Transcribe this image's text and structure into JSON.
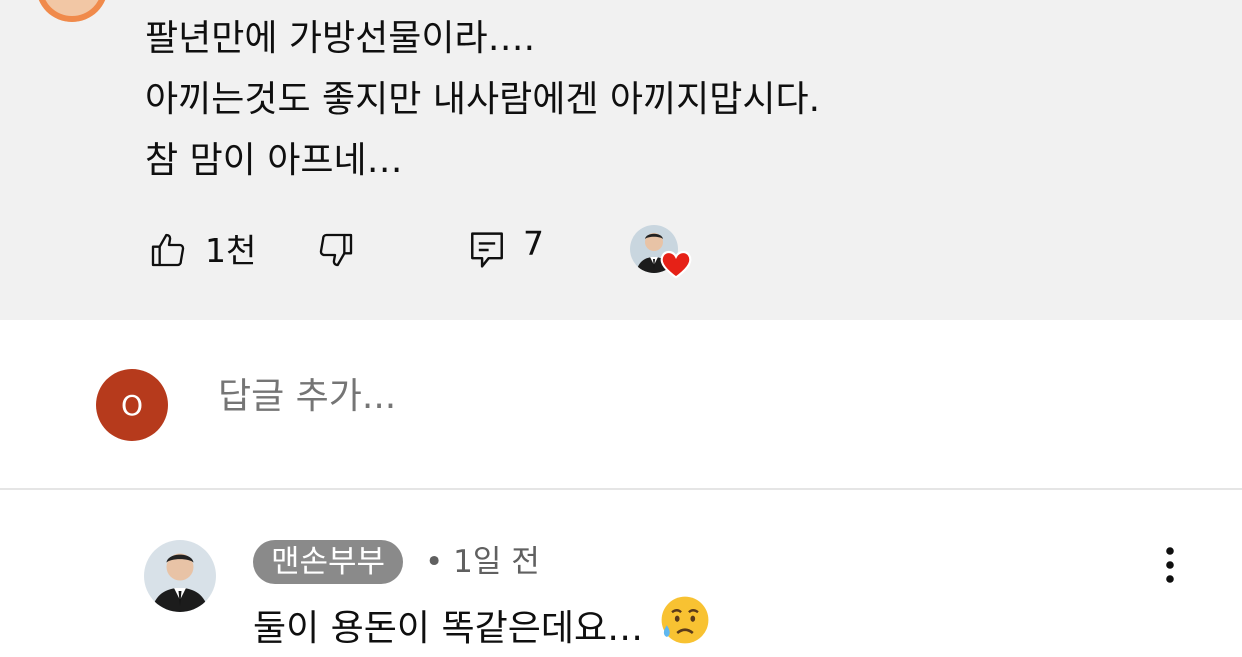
{
  "comment": {
    "lines": [
      "팔년만에 가방선물이라….",
      "아끼는것도 좋지만 내사람에겐 아끼지맙시다.",
      "참 맘이 아프네…"
    ],
    "like_count": "1천",
    "reply_count": "7"
  },
  "reply_box": {
    "user_initial": "O",
    "placeholder": "답글 추가..."
  },
  "reply": {
    "author": "맨손부부",
    "separator": "•",
    "time": "1일 전",
    "text": "둘이 용돈이 똑같은데요…",
    "emoji_icon": "sad-but-relieved-face-icon"
  },
  "colors": {
    "card_bg": "#f1f1f1",
    "user_avatar": "#b63a1c",
    "heart": "#e62117",
    "badge_bg": "#8a8a8a"
  }
}
